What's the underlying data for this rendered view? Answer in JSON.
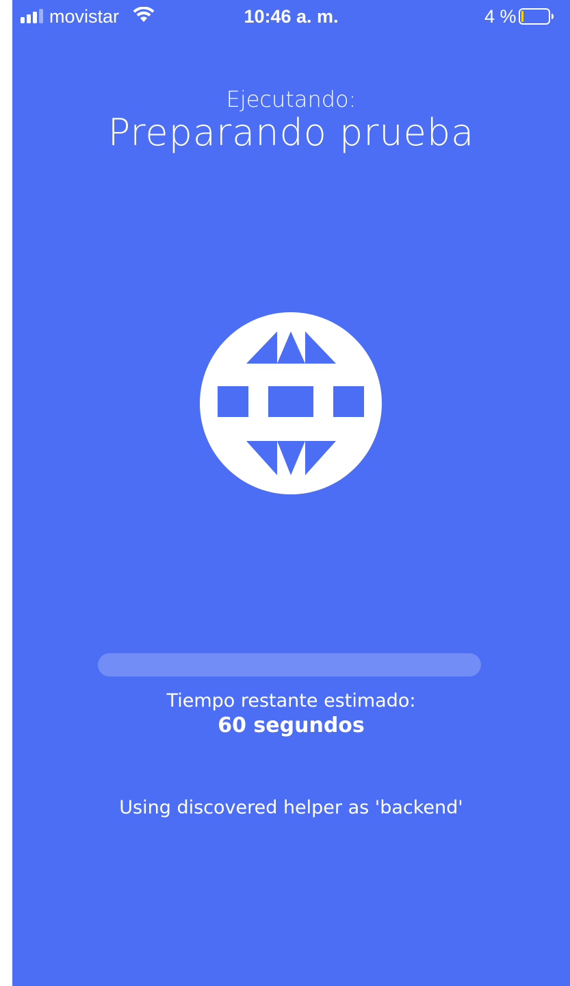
{
  "status_bar": {
    "carrier": "movistar",
    "time": "10:46 a. m.",
    "battery_percent_label": "4 %",
    "battery_level": 0.04
  },
  "header": {
    "status_label": "Ejecutando:",
    "task_name": "Preparando prueba"
  },
  "main": {
    "icon": "globe-icon",
    "progress": 0.0,
    "remaining_label": "Tiempo restante estimado:",
    "remaining_value": "60 segundos",
    "helper_message": "Using discovered helper as 'backend'"
  },
  "colors": {
    "background": "#4C6EF5",
    "foreground": "#FFFFFF",
    "battery_warning": "#FFD400"
  }
}
